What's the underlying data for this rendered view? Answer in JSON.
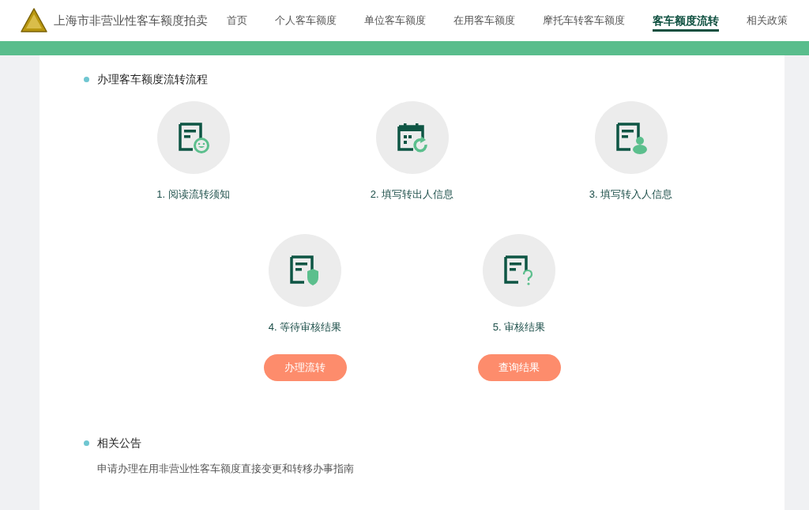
{
  "header": {
    "site_title": "上海市非营业性客车额度拍卖",
    "nav": [
      {
        "label": "首页",
        "selected": false
      },
      {
        "label": "个人客车额度",
        "selected": false
      },
      {
        "label": "单位客车额度",
        "selected": false
      },
      {
        "label": "在用客车额度",
        "selected": false
      },
      {
        "label": "摩托车转客车额度",
        "selected": false
      },
      {
        "label": "客车额度流转",
        "selected": true
      },
      {
        "label": "相关政策",
        "selected": false
      }
    ]
  },
  "process": {
    "heading": "办理客车额度流转流程",
    "rows": [
      [
        {
          "kind": "smile",
          "label": "1. 阅读流转须知"
        },
        {
          "kind": "calendar",
          "label": "2. 填写转出人信息"
        },
        {
          "kind": "person",
          "label": "3. 填写转入人信息"
        }
      ],
      [
        {
          "kind": "shield",
          "label": "4. 等待审核结果",
          "button": "办理流转"
        },
        {
          "kind": "question",
          "label": "5. 审核结果",
          "button": "查询结果"
        }
      ]
    ]
  },
  "notices": {
    "heading": "相关公告",
    "items": [
      "申请办理在用非营业性客车额度直接变更和转移办事指南"
    ]
  }
}
